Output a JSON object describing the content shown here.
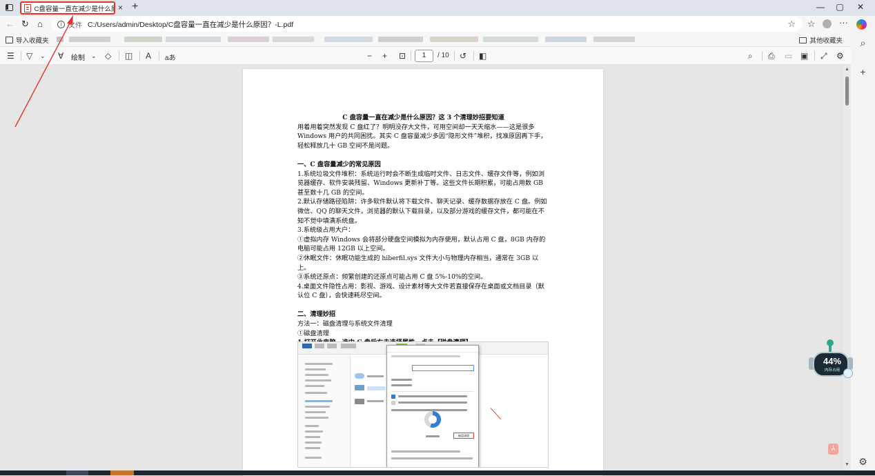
{
  "tab": {
    "title": "C盘容量一直在减少是什么原因?",
    "close": "×",
    "new": "+"
  },
  "window": {
    "minimize": "—",
    "maximize": "▢",
    "close": "✕"
  },
  "address": {
    "file_label": "文件",
    "url": "C:/Users/admin/Desktop/C盘容量一直在减少是什么原因？-L.pdf"
  },
  "favorites": {
    "import": "导入收藏夹",
    "other": "其他收藏夹"
  },
  "pdf_toolbar": {
    "draw": "绘制",
    "page_current": "1",
    "page_total": "/ 10",
    "read_aloud": "A",
    "translate": "aあ"
  },
  "document": {
    "title": "C 盘容量一直在减少是什么原因？这 3 个清理妙招要知道",
    "intro": "用着用着突然发现 C 盘红了？明明没存大文件，可用空间却一天天缩水——这是很多 Windows 用户的共同困扰。其实 C 盘容量减少多因“隐形文件”堆积，找准原因再下手，轻松释放几十 GB 空间不是问题。",
    "section1": "一、C 盘容量减少的常见原因",
    "p1": "1.系统垃圾文件堆积：系统运行时会不断生成临时文件、日志文件、缓存文件等，例如浏览器缓存、软件安装残留、Windows 更新补丁等。这些文件长期积累，可能占用数 GB 甚至数十几 GB 的空间。",
    "p2": "2.默认存储路径陷阱：许多软件默认将下载文件、聊天记录、缓存数据存放在 C 盘。例如微信、QQ 的聊天文件，浏览器的默认下载目录，以及部分游戏的缓存文件，都可能在不知不觉中填满系统盘。",
    "p3": "3.系统级占用大户：",
    "p3a": "①虚拟内存 Windows 会将部分硬盘空间模拟为内存使用，默认占用 C 盘，8GB 内存的电脑可能占用 12GB 以上空间。",
    "p3b": "②休眠文件：休眠功能生成的 hiberfil.sys 文件大小与物理内存相当，通常在 3GB 以上。",
    "p3c": "③系统还原点：频繁创建的还原点可能占用 C 盘 5%-10%的空间。",
    "p4": "4.桌面文件隐性占用：影视、游戏、设计素材等大文件若直接保存在桌面或文档目录（默认位 C 盘），会快速耗尽空间。",
    "section2": "二、清理妙招",
    "m1": "方法一：磁盘清理与系统文件清理",
    "m1a": "①磁盘清理",
    "m1b": "1.打开此电脑，选中 C 盘后右击选择属性，点击【磁盘清理】"
  },
  "widget": {
    "percent": "44%",
    "label": "内存占用"
  },
  "colors": {
    "annotation": "#e5322d",
    "accent": "#2f7fd8",
    "widget_body": "#1b2a35"
  }
}
